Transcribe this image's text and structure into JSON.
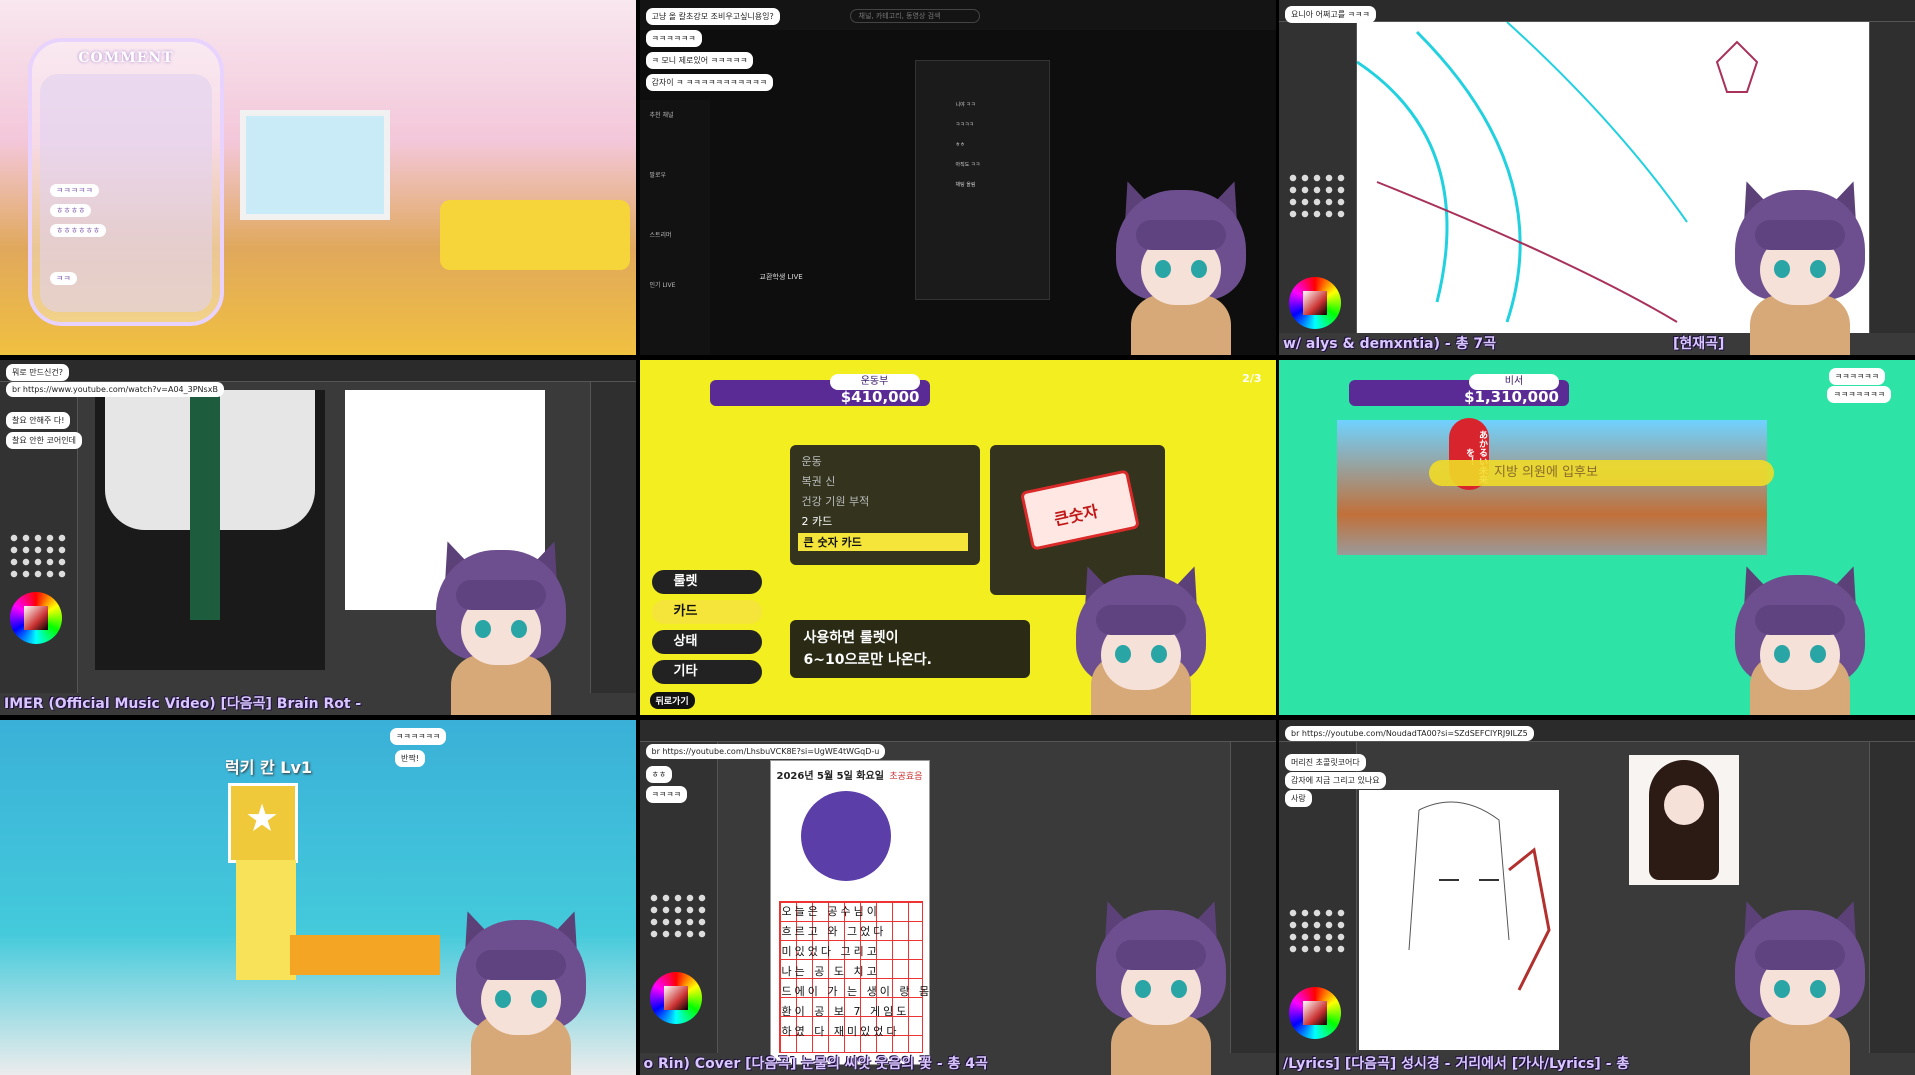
{
  "cell1": {
    "comment_title": "COMMENT",
    "messages": [
      "ㅋㅋㅋㅋㅋ",
      "ㅎㅎㅎㅎ",
      "ㅎㅎㅎㅎㅎㅎ",
      "ㅋㅋ"
    ]
  },
  "cell2": {
    "search_placeholder": "채널, 카테고리, 동영상 검색",
    "chat": [
      "고냥 올 칼초강모 조비우고싶니용잉?",
      "ㅋㅋㅋㅋㅋㅋ",
      "ㅋ 모니 제로있어 ㅋㅋㅋㅋㅋ",
      "감자이 ㅋ ㅋㅋㅋㅋㅋㅋㅋㅋㅋㅋㅋ"
    ],
    "stream_title": "교환학생 LIVE",
    "side_items": [
      "추천 채널",
      "팔로우",
      "스트리머",
      "인기 LIVE"
    ],
    "player_lines": [
      "니야 ㅋㅋ",
      "ㅋㅋㅋㅋ",
      "ㅎㅎ",
      "아직도 ㅋㅋ",
      "채팅 올림"
    ]
  },
  "cell3": {
    "subtitle": "w/ alys & demxntia) - 총 7곡",
    "subtitle_right": "[현재곡]",
    "chat_bubble": "요니아 어쩌고를 ㅋㅋㅋ"
  },
  "cell4": {
    "chat": [
      "뭐로 만드신건?",
      "br https://www.youtube.com/watch?v=A04_3PNsxB",
      "찰요 안해주 다!",
      "찰요 안한 코어인데"
    ],
    "subtitle": "IMER (Official Music Video) [다음곡] Brain Rot -"
  },
  "cell5": {
    "player_name": "운동부",
    "money": "$410,000",
    "menu": [
      "운동",
      "복권 신",
      "건강 기원 부적",
      "2 카드",
      "큰 숫자 카드"
    ],
    "side_menu": [
      "룰렛",
      "카드",
      "상태",
      "기타"
    ],
    "description_line1": "사용하면 룰렛이",
    "description_line2": "6~10으로만 나온다.",
    "card_label": "큰숫자",
    "back_label": "뒤로가기",
    "score": "2/3"
  },
  "cell6": {
    "player_name": "비서",
    "money": "$1,310,000",
    "banner": "지방 의원에 입후보",
    "sign": "あかるい未来を！",
    "chat": [
      "ㅋㅋㅋㅋㅋㅋ",
      "ㅋㅋㅋㅋㅋㅋㅋ"
    ]
  },
  "cell7": {
    "luck_label": "럭키 칸 Lv1",
    "chat": [
      "ㅋㅋㅋㅋㅋㅋ",
      "반짝!"
    ]
  },
  "cell8": {
    "diary_date": "2026년 5월 5일 화요일",
    "diary_title": "초공효음",
    "grid_lines": [
      "오늘은 공수님이",
      "흐르고 와 그었다",
      "미있었다 그리고",
      "나는 공 도 치고",
      "드에이 가 는 생이 랑 몸",
      "환이 공 보 7 게임도",
      "하였 다 재미있었다"
    ],
    "subtitle": "o Rin) Cover [다음곡] 눈물의 씨앗 웃음의 꽃 - 총 4곡",
    "chat": [
      "br https://youtube.com/LhsbuVCK8E?si=UgWE4tWGqD-u",
      "ㅎㅎ",
      "ㅋㅋㅋㅋ"
    ]
  },
  "cell9": {
    "subtitle": "/Lyrics] [다음곡] 성시경 - 거리에서 [가사/Lyrics] - 총",
    "chat": [
      "br https://youtube.com/NoudadTA00?si=SZdSEFCIYRJ9ILZ5",
      "머리진 초콜릿코어다",
      "감자에 지금 그리고 있나요",
      "사랑"
    ]
  },
  "colors": {
    "accent": "#5a2a95",
    "highlight": "#f5e53a"
  }
}
